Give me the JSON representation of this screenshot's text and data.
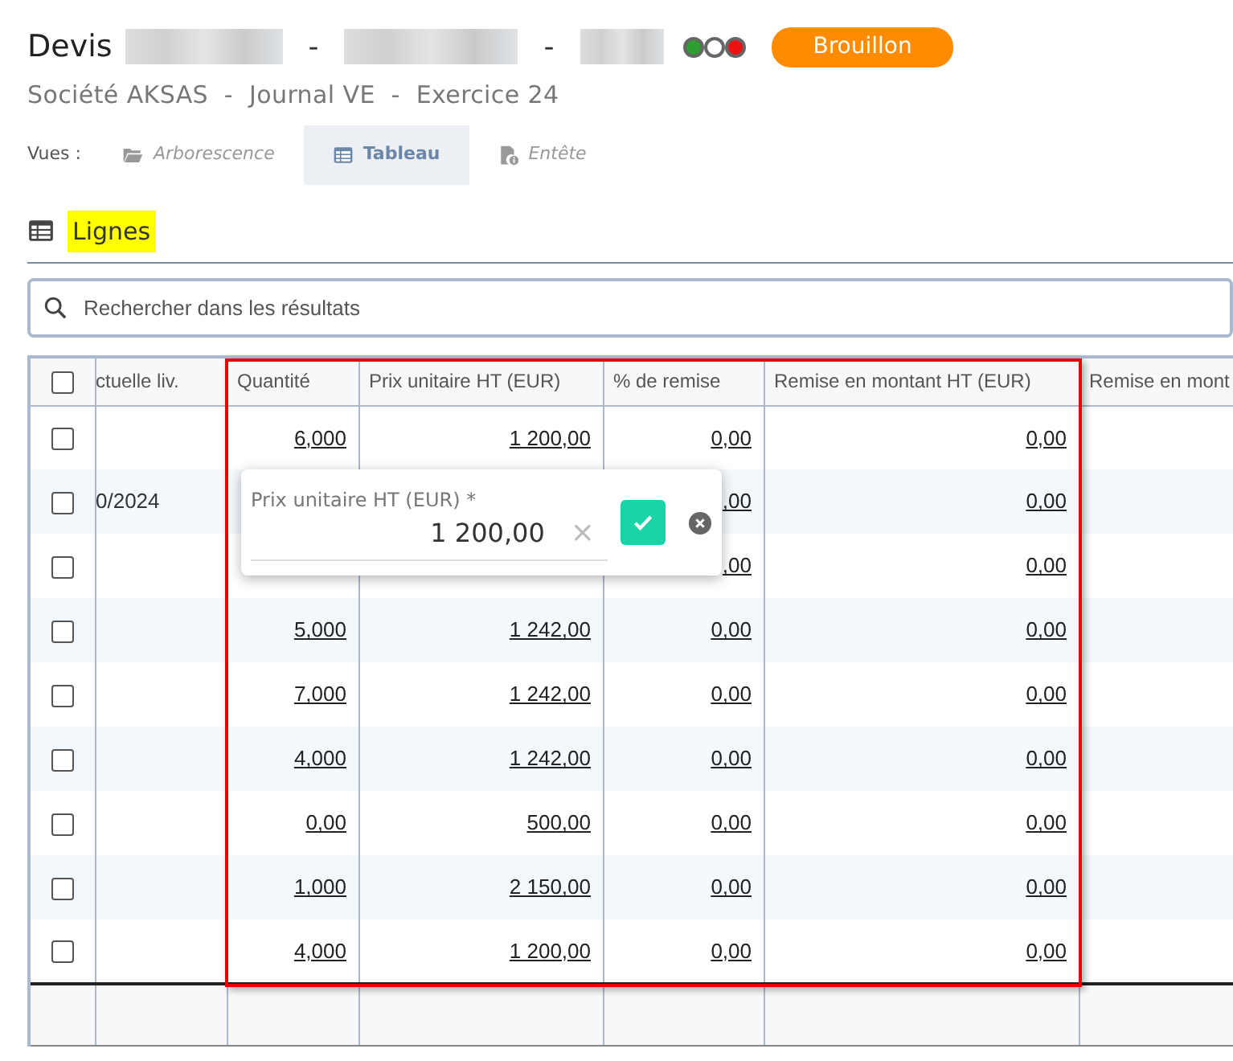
{
  "header": {
    "title": "Devis",
    "title_parts": [
      {
        "kind": "redacted"
      },
      {
        "kind": "separator",
        "text": "-"
      },
      {
        "kind": "redacted"
      },
      {
        "kind": "separator",
        "text": "-"
      },
      {
        "kind": "redacted"
      }
    ],
    "status_dots": [
      {
        "color": "#2e9e2e"
      },
      {
        "color": "#ffffff"
      },
      {
        "color": "#ee1111"
      }
    ],
    "status_badge": "Brouillon",
    "subtitle": "Société AKSAS  -  Journal VE  -  Exercice 24"
  },
  "views": {
    "label": "Vues :",
    "tabs": [
      {
        "label": "Arborescence",
        "kind": "folder",
        "selected": false
      },
      {
        "label": "Tableau",
        "kind": "table",
        "selected": true
      },
      {
        "label": "Entête",
        "kind": "doc",
        "selected": false
      }
    ]
  },
  "section": {
    "title": "Lignes"
  },
  "search": {
    "placeholder": "Rechercher dans les résultats"
  },
  "table": {
    "header_checked": false,
    "columns": [
      {
        "label": "ctuelle liv.",
        "selected": false
      },
      {
        "label": "Quantité",
        "selected": true
      },
      {
        "label": "Prix unitaire HT (EUR)",
        "selected": true
      },
      {
        "label": "% de remise",
        "selected": true
      },
      {
        "label": "Remise en montant HT (EUR)",
        "selected": true
      },
      {
        "label": "Remise en mont",
        "selected": false
      }
    ],
    "rows": [
      {
        "checked": false,
        "cells": [
          "",
          "6,000",
          "1 200,00",
          "0,00",
          "0,00",
          ""
        ]
      },
      {
        "checked": false,
        "cells": [
          "0/2024",
          "",
          "",
          ",00",
          "0,00",
          ""
        ]
      },
      {
        "checked": false,
        "cells": [
          "",
          "",
          "",
          ",00",
          "0,00",
          ""
        ]
      },
      {
        "checked": false,
        "cells": [
          "",
          "5,000",
          "1 242,00",
          "0,00",
          "0,00",
          ""
        ]
      },
      {
        "checked": false,
        "cells": [
          "",
          "7,000",
          "1 242,00",
          "0,00",
          "0,00",
          ""
        ]
      },
      {
        "checked": false,
        "cells": [
          "",
          "4,000",
          "1 242,00",
          "0,00",
          "0,00",
          ""
        ]
      },
      {
        "checked": false,
        "cells": [
          "",
          "0,00",
          "500,00",
          "0,00",
          "0,00",
          ""
        ]
      },
      {
        "checked": false,
        "cells": [
          "",
          "1,000",
          "2 150,00",
          "0,00",
          "0,00",
          ""
        ]
      },
      {
        "checked": false,
        "cells": [
          "",
          "4,000",
          "1 200,00",
          "0,00",
          "0,00",
          ""
        ]
      }
    ]
  },
  "editor": {
    "label": "Prix unitaire HT (EUR) *",
    "value": "1 200,00",
    "clear": "×"
  }
}
